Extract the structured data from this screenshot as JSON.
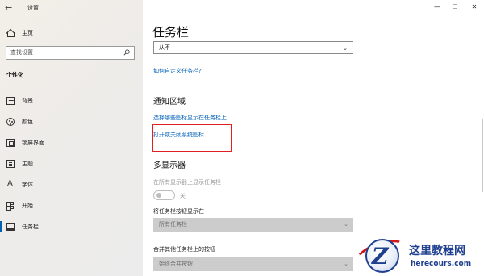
{
  "window": {
    "title": "设置",
    "controls": [
      "—",
      "☐",
      "✕"
    ]
  },
  "sidebar": {
    "home_label": "主页",
    "search_placeholder": "查找设置",
    "section": "个性化",
    "items": [
      {
        "label": "背景",
        "icon": "background-icon"
      },
      {
        "label": "颜色",
        "icon": "color-palette-icon"
      },
      {
        "label": "锁屏界面",
        "icon": "lock-screen-icon"
      },
      {
        "label": "主题",
        "icon": "theme-icon"
      },
      {
        "label": "字体",
        "icon": "font-icon"
      },
      {
        "label": "开始",
        "icon": "start-icon"
      },
      {
        "label": "任务栏",
        "icon": "taskbar-icon",
        "active": true
      }
    ],
    "accent": "#0063b1"
  },
  "main": {
    "title": "任务栏",
    "dropdown_value": "从不",
    "customize_link": "如何自定义任务栏?",
    "notification": {
      "title": "通知区域",
      "link1": "选择哪些图标显示在任务栏上",
      "link2": "打开或关闭系统图标"
    },
    "multi_display": {
      "title": "多显示器",
      "show_all_label": "在所有显示器上显示任务栏",
      "toggle_state": "关",
      "show_buttons_label": "将任务栏按钮显示在",
      "show_buttons_value": "所有任务栏",
      "combine_label": "合并其他任务栏上的按钮",
      "combine_value": "始终合并按钮"
    },
    "highlight_color": "#e02020",
    "link_color": "#0060b8"
  },
  "watermark": {
    "logo_letter": "Z",
    "title": "这里教程网",
    "url": "herecours.com"
  }
}
